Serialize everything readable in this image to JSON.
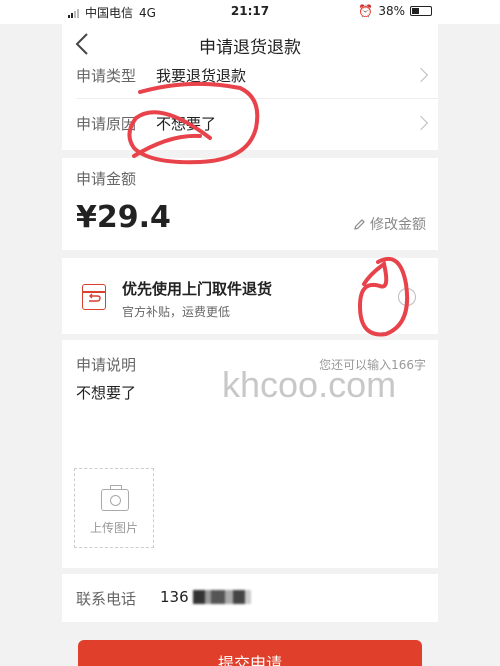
{
  "status_bar": {
    "carrier": "中国电信",
    "network": "4G",
    "time": "21:17",
    "battery": "38%"
  },
  "nav": {
    "title": "申请退货退款"
  },
  "request_type": {
    "label": "申请类型",
    "value": "我要退货退款"
  },
  "request_reason": {
    "label": "申请原因",
    "value": "不想要了"
  },
  "amount": {
    "label": "申请金额",
    "value": "¥29.4",
    "modify_label": "修改金额"
  },
  "pickup": {
    "title": "优先使用上门取件退货",
    "subtitle": "官方补贴，运费更低",
    "selected": false
  },
  "description": {
    "label": "申请说明",
    "hint": "您还可以输入166字",
    "text": "不想要了"
  },
  "upload": {
    "label": "上传图片"
  },
  "contact": {
    "label": "联系电话",
    "value": "136"
  },
  "submit": {
    "label": "提交申请"
  },
  "watermark": "khcoo.com",
  "colors": {
    "accent": "#e0402b",
    "annotation": "#e8424a"
  },
  "icons": [
    "back-icon",
    "chevron-right-icon",
    "edit-icon",
    "pickup-box-icon",
    "camera-icon",
    "signal-icon",
    "alarm-icon",
    "battery-icon"
  ]
}
